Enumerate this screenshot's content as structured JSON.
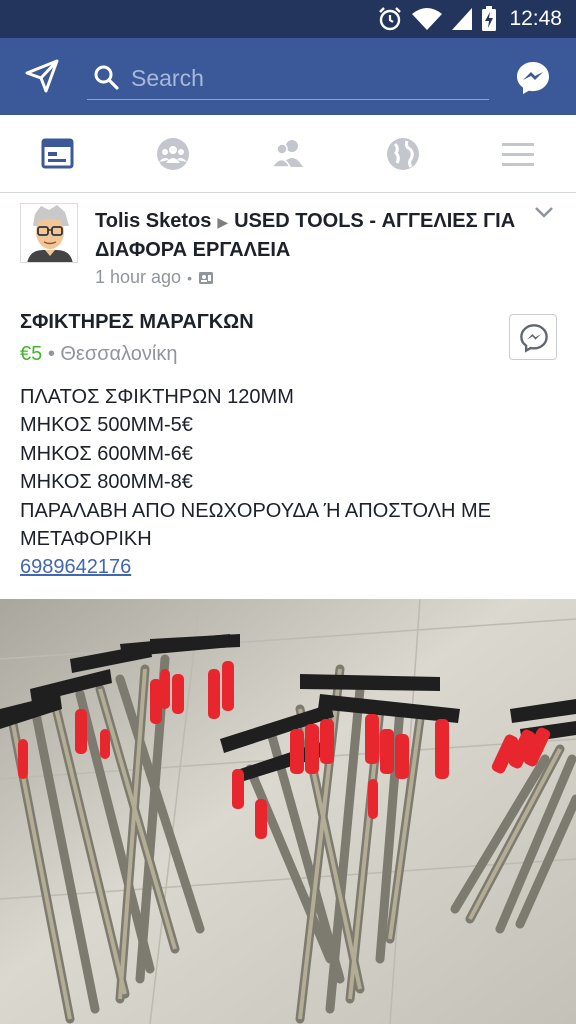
{
  "status_bar": {
    "time": "12:48"
  },
  "search": {
    "placeholder": "Search"
  },
  "nav": {
    "items": [
      "news-feed",
      "groups",
      "friend-requests",
      "notifications",
      "menu"
    ],
    "active": "news-feed"
  },
  "post": {
    "author": "Tolis Sketos",
    "group": "USED TOOLS - ΑΓΓΕΛΙΕΣ ΓΙΑ ΔΙΑΦΟΡΑ ΕΡΓΑΛΕΙΑ",
    "time": "1 hour ago",
    "title": "ΣΦΙΚΤΗΡΕΣ ΜΑΡΑΓΚΩΝ",
    "price": "€5",
    "location": "Θεσσαλονίκη",
    "lines": [
      "ΠΛΑΤΟΣ ΣΦΙΚΤΗΡΩΝ 120ΜΜ",
      "ΜΗΚΟΣ 500ΜΜ-5€",
      "ΜΗΚΟΣ 600ΜΜ-6€",
      "ΜΗΚΟΣ 800ΜΜ-8€",
      "ΠΑΡΑΛΑΒΗ ΑΠΟ ΝΕΩΧΟΡΟΥΔΑ Ή ΑΠΟΣΤΟΛΗ ΜΕ",
      "ΜΕΤΑΦΟΡΙΚΗ"
    ],
    "phone": "6989642176"
  },
  "colors": {
    "status_bar": "#23355c",
    "brand": "#3b5998",
    "price_green": "#42b72a",
    "link": "#4267b2",
    "clamp_handle": "#e8262d"
  }
}
